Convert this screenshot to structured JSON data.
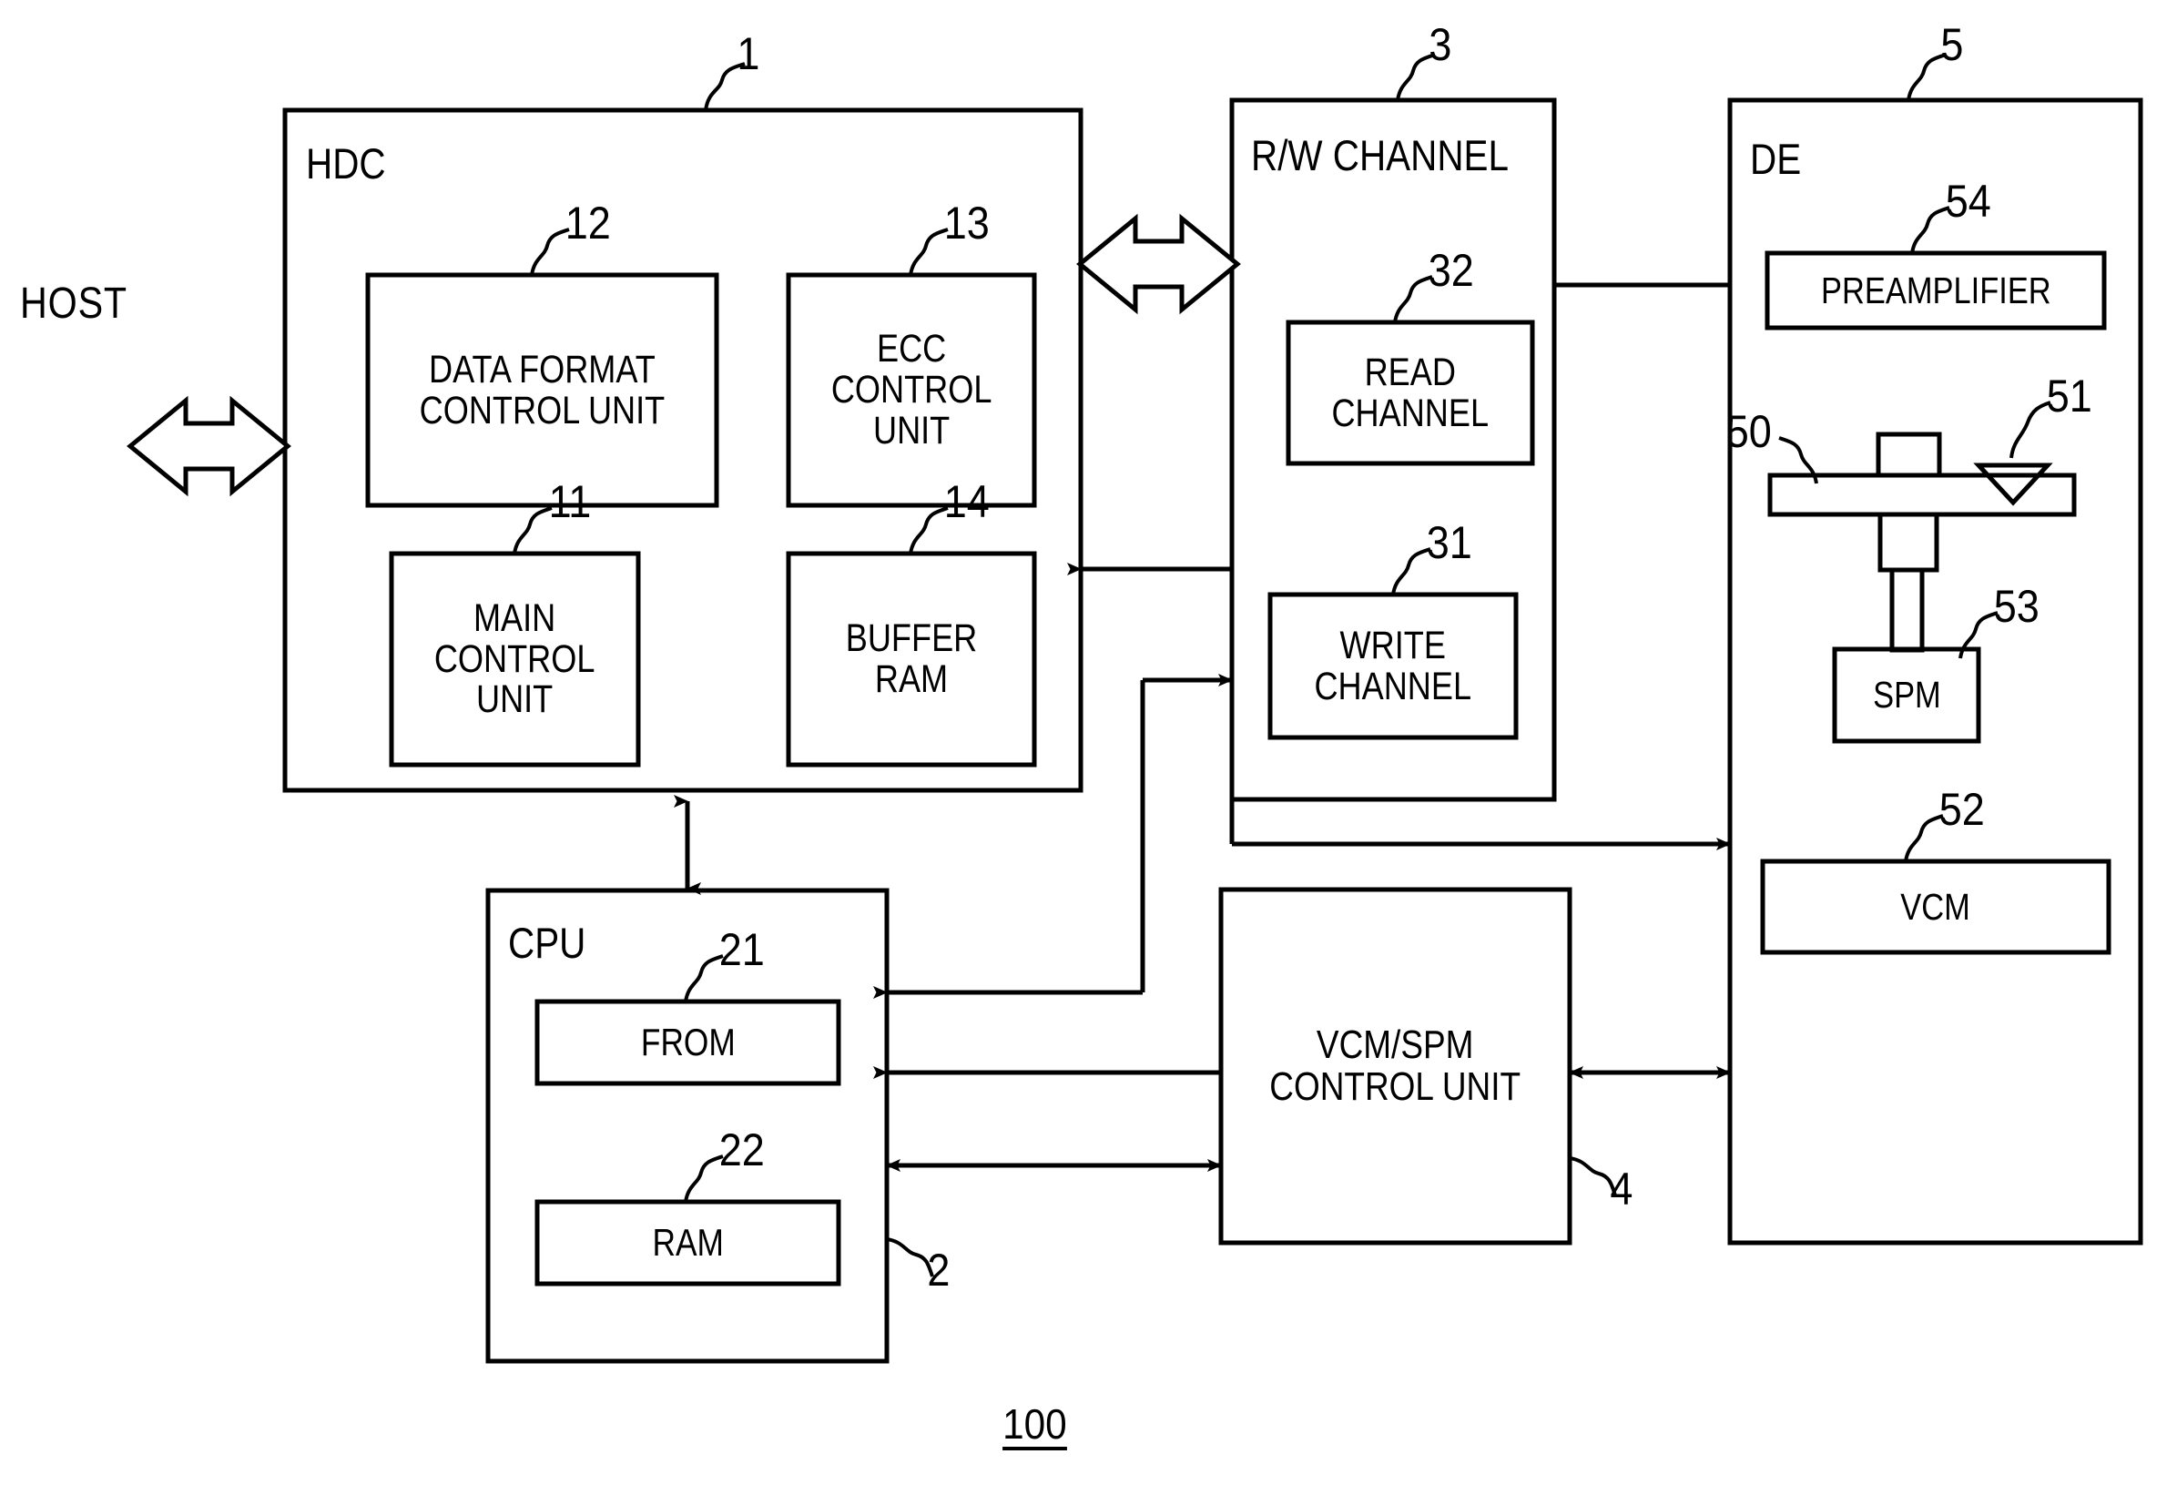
{
  "figure": {
    "number": "100",
    "host_label": "HOST"
  },
  "blocks": {
    "hdc": {
      "title": "HDC",
      "ref": "1",
      "children": [
        {
          "key": "data_format_control_unit",
          "label": "DATA FORMAT\nCONTROL UNIT",
          "ref": "12"
        },
        {
          "key": "ecc_control_unit",
          "label": "ECC\nCONTROL\nUNIT",
          "ref": "13"
        },
        {
          "key": "main_control_unit",
          "label": "MAIN\nCONTROL\nUNIT",
          "ref": "11"
        },
        {
          "key": "buffer_ram",
          "label": "BUFFER\nRAM",
          "ref": "14"
        }
      ]
    },
    "rw_channel": {
      "title": "R/W CHANNEL",
      "ref": "3",
      "children": [
        {
          "key": "read_channel",
          "label": "READ\nCHANNEL",
          "ref": "32"
        },
        {
          "key": "write_channel",
          "label": "WRITE\nCHANNEL",
          "ref": "31"
        }
      ]
    },
    "de": {
      "title": "DE",
      "ref": "5",
      "children": [
        {
          "key": "preamplifier",
          "label": "PREAMPLIFIER",
          "ref": "54"
        },
        {
          "key": "disk",
          "label": "",
          "ref": "50"
        },
        {
          "key": "head",
          "label": "",
          "ref": "51"
        },
        {
          "key": "spm",
          "label": "SPM",
          "ref": "53"
        },
        {
          "key": "vcm",
          "label": "VCM",
          "ref": "52"
        }
      ]
    },
    "cpu": {
      "title": "CPU",
      "ref": "2",
      "children": [
        {
          "key": "from",
          "label": "FROM",
          "ref": "21"
        },
        {
          "key": "ram",
          "label": "RAM",
          "ref": "22"
        }
      ]
    },
    "vcm_spm_control_unit": {
      "title": "VCM/SPM\nCONTROL UNIT",
      "ref": "4"
    }
  },
  "colors": {
    "stroke": "#000000",
    "background": "#ffffff"
  }
}
